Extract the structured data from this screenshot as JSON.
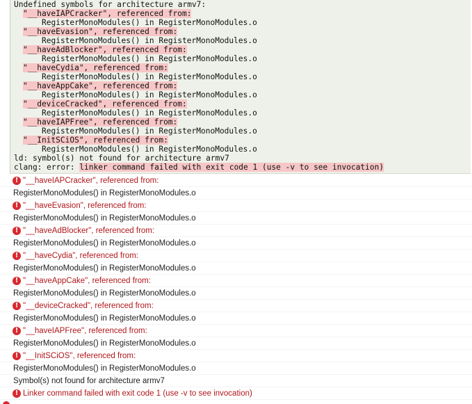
{
  "log": {
    "header": "Undefined symbols for architecture armv7:",
    "entries": [
      {
        "symbol": "\"__haveIAPCracker\", referenced from:",
        "ref": "RegisterMonoModules() in RegisterMonoModules.o"
      },
      {
        "symbol": "\"__haveEvasion\", referenced from:",
        "ref": "RegisterMonoModules() in RegisterMonoModules.o"
      },
      {
        "symbol": "\"__haveAdBlocker\", referenced from:",
        "ref": "RegisterMonoModules() in RegisterMonoModules.o"
      },
      {
        "symbol": "\"__haveCydia\", referenced from:",
        "ref": "RegisterMonoModules() in RegisterMonoModules.o"
      },
      {
        "symbol": "\"__haveAppCake\", referenced from:",
        "ref": "RegisterMonoModules() in RegisterMonoModules.o"
      },
      {
        "symbol": "\"__deviceCracked\", referenced from:",
        "ref": "RegisterMonoModules() in RegisterMonoModules.o"
      },
      {
        "symbol": "\"__haveIAPFree\", referenced from:",
        "ref": "RegisterMonoModules() in RegisterMonoModules.o"
      },
      {
        "symbol": "\"__InitSCiOS\", referenced from:",
        "ref": "RegisterMonoModules() in RegisterMonoModules.o"
      }
    ],
    "footer_ld": "ld: symbol(s) not found for architecture armv7",
    "footer_clang_prefix": "clang: error: ",
    "footer_clang_msg": "linker command failed with exit code 1 (use -v to see invocation)"
  },
  "issues": [
    {
      "error": "\"__haveIAPCracker\", referenced from:",
      "detail": "RegisterMonoModules() in RegisterMonoModules.o"
    },
    {
      "error": "\"__haveEvasion\", referenced from:",
      "detail": "RegisterMonoModules() in RegisterMonoModules.o"
    },
    {
      "error": "\"__haveAdBlocker\", referenced from:",
      "detail": "RegisterMonoModules() in RegisterMonoModules.o"
    },
    {
      "error": "\"__haveCydia\", referenced from:",
      "detail": "RegisterMonoModules() in RegisterMonoModules.o"
    },
    {
      "error": "\"__haveAppCake\", referenced from:",
      "detail": "RegisterMonoModules() in RegisterMonoModules.o"
    },
    {
      "error": "\"__deviceCracked\", referenced from:",
      "detail": "RegisterMonoModules() in RegisterMonoModules.o"
    },
    {
      "error": "\"__haveIAPFree\", referenced from:",
      "detail": "RegisterMonoModules() in RegisterMonoModules.o"
    },
    {
      "error": "\"__InitSCiOS\", referenced from:",
      "detail": "RegisterMonoModules() in RegisterMonoModules.o"
    }
  ],
  "summary_line": "Symbol(s) not found for architecture armv7",
  "final_error": "Linker command failed with exit code 1 (use -v to see invocation)",
  "error_icon_glyph": "!",
  "colors": {
    "error_red": "#d8292f",
    "error_text": "#b0171b",
    "log_bg": "#eef1e9",
    "highlight": "#f7c6c6"
  }
}
